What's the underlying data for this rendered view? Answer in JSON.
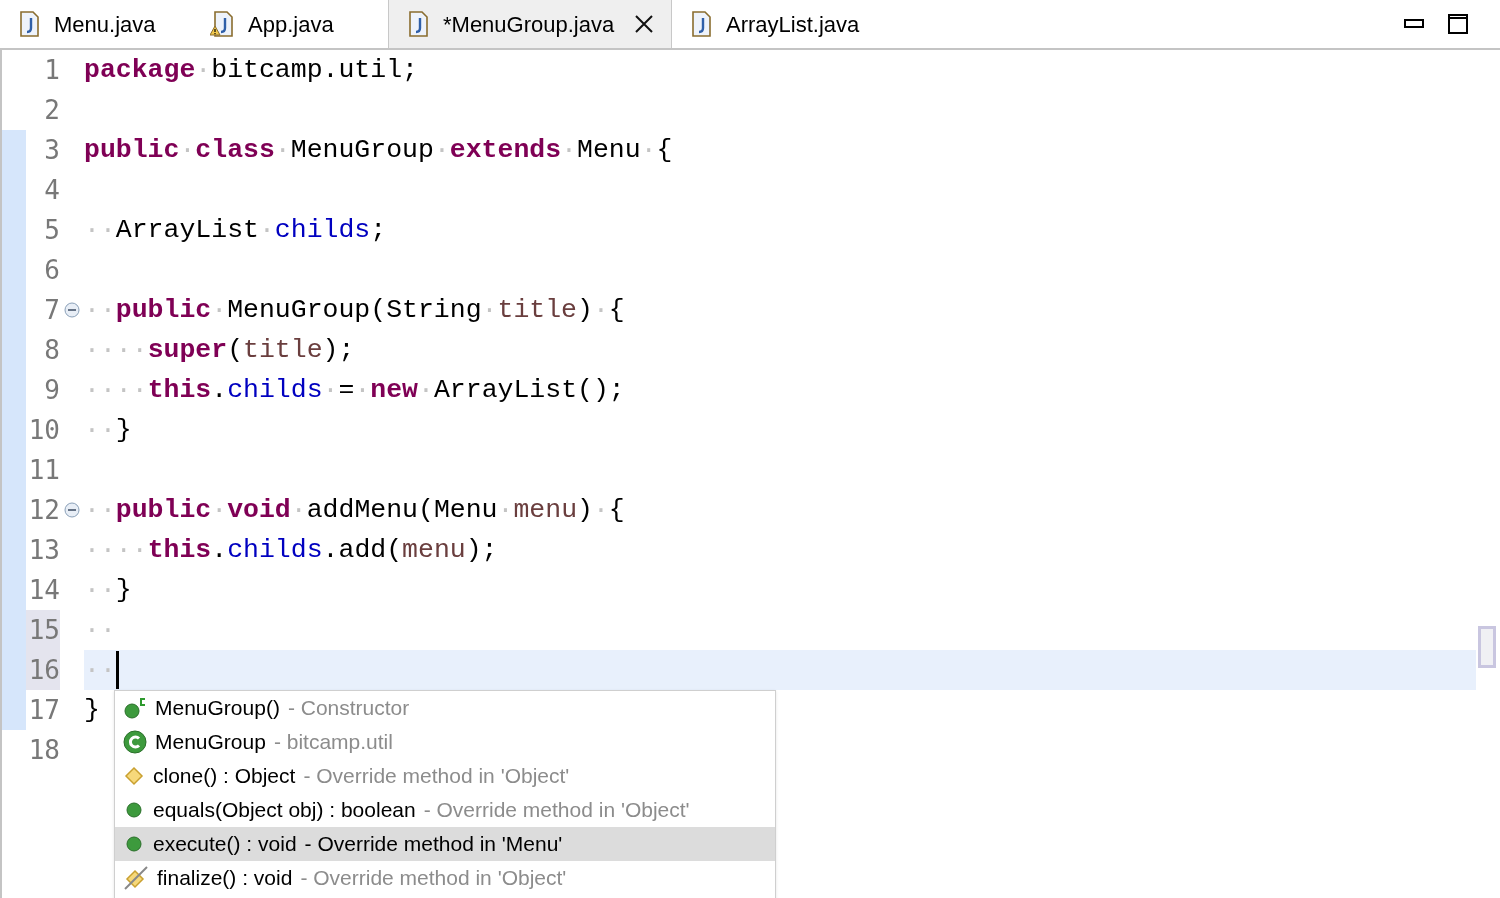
{
  "tabs": [
    {
      "label": "Menu.java",
      "selected": false,
      "warning": false,
      "dirty_close": false
    },
    {
      "label": "App.java",
      "selected": false,
      "warning": true,
      "dirty_close": false
    },
    {
      "label": "*MenuGroup.java",
      "selected": true,
      "warning": false,
      "dirty_close": true
    },
    {
      "label": "ArrayList.java",
      "selected": false,
      "warning": false,
      "dirty_close": false
    }
  ],
  "editor": {
    "lines": [
      {
        "number": "1",
        "changed": false,
        "marked": false,
        "fold": false,
        "current": false,
        "tokens": [
          {
            "kind": "kw",
            "text": "package"
          },
          {
            "kind": "ws",
            "text": "·"
          },
          {
            "kind": "plain",
            "text": "bitcamp.util;"
          }
        ]
      },
      {
        "number": "2",
        "changed": false,
        "marked": false,
        "fold": false,
        "current": false
      },
      {
        "number": "3",
        "changed": true,
        "marked": false,
        "fold": false,
        "current": false,
        "tokens": [
          {
            "kind": "kw",
            "text": "public"
          },
          {
            "kind": "ws",
            "text": "·"
          },
          {
            "kind": "kw",
            "text": "class"
          },
          {
            "kind": "ws",
            "text": "·"
          },
          {
            "kind": "plain",
            "text": "MenuGroup"
          },
          {
            "kind": "ws",
            "text": "·"
          },
          {
            "kind": "kw",
            "text": "extends"
          },
          {
            "kind": "ws",
            "text": "·"
          },
          {
            "kind": "plain",
            "text": "Menu"
          },
          {
            "kind": "ws",
            "text": "·"
          },
          {
            "kind": "plain",
            "text": "{"
          }
        ]
      },
      {
        "number": "4",
        "changed": true,
        "marked": false,
        "fold": false,
        "current": false
      },
      {
        "number": "5",
        "changed": true,
        "marked": false,
        "fold": false,
        "current": false,
        "tokens": [
          {
            "kind": "ws",
            "text": "··"
          },
          {
            "kind": "plain",
            "text": "ArrayList"
          },
          {
            "kind": "ws",
            "text": "·"
          },
          {
            "kind": "field",
            "text": "childs"
          },
          {
            "kind": "plain",
            "text": ";"
          }
        ]
      },
      {
        "number": "6",
        "changed": true,
        "marked": false,
        "fold": false,
        "current": false
      },
      {
        "number": "7",
        "changed": true,
        "marked": false,
        "fold": true,
        "current": false,
        "tokens": [
          {
            "kind": "ws",
            "text": "··"
          },
          {
            "kind": "kw",
            "text": "public"
          },
          {
            "kind": "ws",
            "text": "·"
          },
          {
            "kind": "plain",
            "text": "MenuGroup(String"
          },
          {
            "kind": "ws",
            "text": "·"
          },
          {
            "kind": "param",
            "text": "title"
          },
          {
            "kind": "plain",
            "text": ")"
          },
          {
            "kind": "ws",
            "text": "·"
          },
          {
            "kind": "plain",
            "text": "{"
          }
        ]
      },
      {
        "number": "8",
        "changed": true,
        "marked": false,
        "fold": false,
        "current": false,
        "tokens": [
          {
            "kind": "ws",
            "text": "····"
          },
          {
            "kind": "kw",
            "text": "super"
          },
          {
            "kind": "plain",
            "text": "("
          },
          {
            "kind": "param",
            "text": "title"
          },
          {
            "kind": "plain",
            "text": ");"
          }
        ]
      },
      {
        "number": "9",
        "changed": true,
        "marked": false,
        "fold": false,
        "current": false,
        "tokens": [
          {
            "kind": "ws",
            "text": "····"
          },
          {
            "kind": "kw",
            "text": "this"
          },
          {
            "kind": "plain",
            "text": "."
          },
          {
            "kind": "field",
            "text": "childs"
          },
          {
            "kind": "ws",
            "text": "·"
          },
          {
            "kind": "plain",
            "text": "="
          },
          {
            "kind": "ws",
            "text": "·"
          },
          {
            "kind": "kw",
            "text": "new"
          },
          {
            "kind": "ws",
            "text": "·"
          },
          {
            "kind": "plain",
            "text": "ArrayList();"
          }
        ]
      },
      {
        "number": "10",
        "changed": true,
        "marked": false,
        "fold": false,
        "current": false,
        "tokens": [
          {
            "kind": "ws",
            "text": "··"
          },
          {
            "kind": "plain",
            "text": "}"
          }
        ]
      },
      {
        "number": "11",
        "changed": true,
        "marked": false,
        "fold": false,
        "current": false
      },
      {
        "number": "12",
        "changed": true,
        "marked": false,
        "fold": true,
        "current": false,
        "tokens": [
          {
            "kind": "ws",
            "text": "··"
          },
          {
            "kind": "kw",
            "text": "public"
          },
          {
            "kind": "ws",
            "text": "·"
          },
          {
            "kind": "kw",
            "text": "void"
          },
          {
            "kind": "ws",
            "text": "·"
          },
          {
            "kind": "plain",
            "text": "addMenu(Menu"
          },
          {
            "kind": "ws",
            "text": "·"
          },
          {
            "kind": "param",
            "text": "menu"
          },
          {
            "kind": "plain",
            "text": ")"
          },
          {
            "kind": "ws",
            "text": "·"
          },
          {
            "kind": "plain",
            "text": "{"
          }
        ]
      },
      {
        "number": "13",
        "changed": true,
        "marked": false,
        "fold": false,
        "current": false,
        "tokens": [
          {
            "kind": "ws",
            "text": "····"
          },
          {
            "kind": "kw",
            "text": "this"
          },
          {
            "kind": "plain",
            "text": "."
          },
          {
            "kind": "field",
            "text": "childs"
          },
          {
            "kind": "plain",
            "text": ".add("
          },
          {
            "kind": "param",
            "text": "menu"
          },
          {
            "kind": "plain",
            "text": ");"
          }
        ]
      },
      {
        "number": "14",
        "changed": true,
        "marked": false,
        "fold": false,
        "current": false,
        "tokens": [
          {
            "kind": "ws",
            "text": "··"
          },
          {
            "kind": "plain",
            "text": "}"
          }
        ]
      },
      {
        "number": "15",
        "changed": true,
        "marked": true,
        "fold": false,
        "current": false,
        "tokens": [
          {
            "kind": "ws",
            "text": "··"
          }
        ]
      },
      {
        "number": "16",
        "changed": true,
        "marked": true,
        "fold": false,
        "current": true,
        "tokens": [
          {
            "kind": "ws",
            "text": "··"
          }
        ]
      },
      {
        "number": "17",
        "changed": true,
        "marked": false,
        "fold": false,
        "current": false,
        "tokens": [
          {
            "kind": "plain",
            "text": "}"
          }
        ]
      },
      {
        "number": "18",
        "changed": false,
        "marked": false,
        "fold": false,
        "current": false
      }
    ]
  },
  "completion": {
    "items": [
      {
        "kind": "constructor",
        "label": "MenuGroup()",
        "detail": "- Constructor",
        "selected": false
      },
      {
        "kind": "class",
        "label": "MenuGroup",
        "detail": "- bitcamp.util",
        "selected": false
      },
      {
        "kind": "protected",
        "label": "clone() : Object",
        "detail": "- Override method in 'Object'",
        "selected": false
      },
      {
        "kind": "public",
        "label": "equals(Object obj) : boolean",
        "detail": "- Override method in 'Object'",
        "selected": false
      },
      {
        "kind": "public",
        "label": "execute() : void",
        "detail": "- Override method in 'Menu'",
        "selected": true
      },
      {
        "kind": "deprecated",
        "label": "finalize() : void",
        "detail": "- Override method in 'Object'",
        "selected": false
      }
    ]
  }
}
